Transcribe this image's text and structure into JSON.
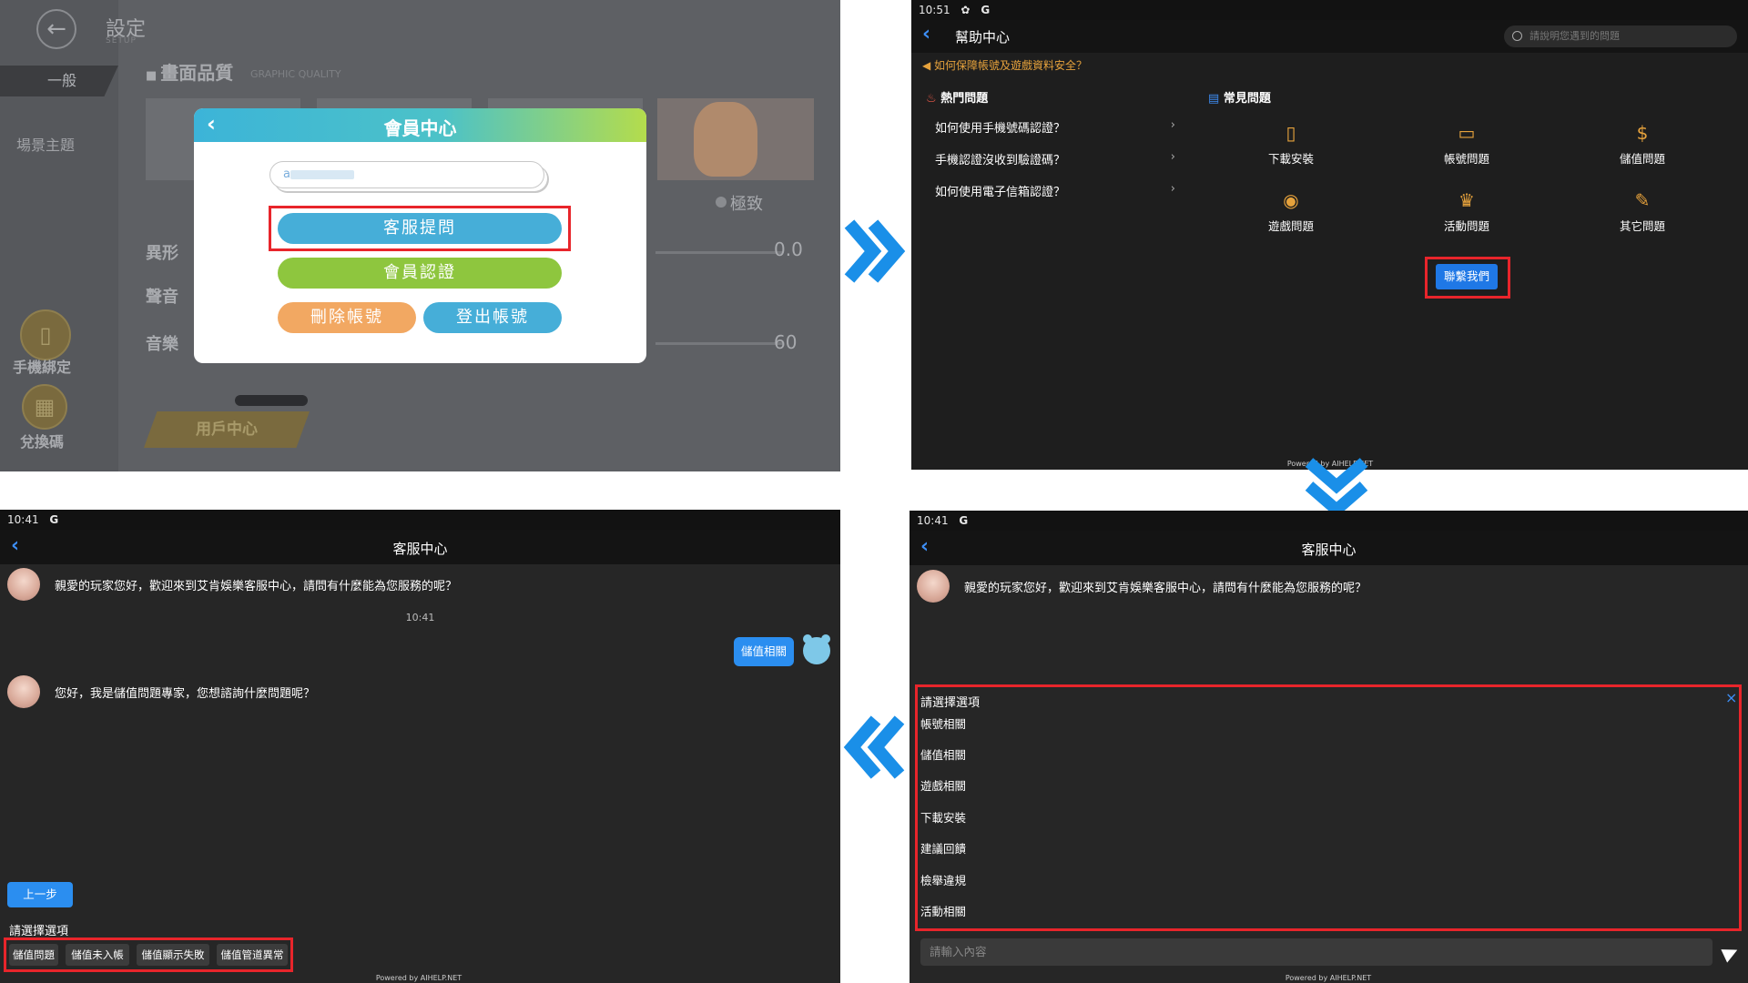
{
  "panel1": {
    "settings_title": "設定",
    "settings_subtitle": "SETUP",
    "tab_general": "一般",
    "tab_scene": "場景主題",
    "graphic_quality": "畫面品質",
    "graphic_quality_en": "GRAPHIC QUALITY",
    "ultra_label": "極致",
    "row_label_1": "異形",
    "row_label_2": "聲音",
    "row_label_3": "音樂",
    "value_1": "0.0",
    "value_3": "60",
    "phone_bind": "手機綁定",
    "redeem_code": "兌換碼",
    "user_center": "用戶中心",
    "modal": {
      "title": "會員中心",
      "account_prefix": "a",
      "btn_customer_service": "客服提問",
      "btn_member_verify": "會員認證",
      "btn_delete_account": "刪除帳號",
      "btn_logout": "登出帳號"
    }
  },
  "panel2": {
    "time": "10:51",
    "status_g": "G",
    "title": "幫助中心",
    "search_placeholder": "請說明您遇到的問題",
    "notice": "如何保障帳號及遊戲資料安全？",
    "hot_title": "熱門問題",
    "hot_items": [
      "如何使用手機號碼認證？",
      "手機認證沒收到驗證碼？",
      "如何使用電子信箱認證？"
    ],
    "chevron": "›",
    "faq_title": "常見問題",
    "faq_items": [
      "下載安裝",
      "帳號問題",
      "儲值問題",
      "遊戲問題",
      "活動問題",
      "其它問題"
    ],
    "contact_button": "聯繫我們",
    "powered": "Powered by AIHELP.NET"
  },
  "panel3": {
    "time": "10:41",
    "status_g": "G",
    "title": "客服中心",
    "greeting": "親愛的玩家您好，歡迎來到艾肯娛樂客服中心，請問有什麼能為您服務的呢？",
    "choice_title": "請選擇選項",
    "close": "×",
    "choices": [
      "帳號相關",
      "儲值相關",
      "遊戲相關",
      "下載安裝",
      "建議回饋",
      "檢舉違規",
      "活動相關"
    ],
    "input_placeholder": "請輸入內容",
    "powered": "Powered by AIHELP.NET"
  },
  "panel4": {
    "time": "10:41",
    "status_g": "G",
    "title": "客服中心",
    "greeting": "親愛的玩家您好，歡迎來到艾肯娛樂客服中心，請問有什麼能為您服務的呢？",
    "msg_time": "10:41",
    "user_message": "儲值相關",
    "reply": "您好，我是儲值問題專家，您想諮詢什麼問題呢？",
    "prev_button": "上一步",
    "choice_title": "請選擇選項",
    "chips": [
      "儲值問題",
      "儲值未入帳",
      "儲值顯示失敗",
      "儲值管道異常"
    ],
    "powered": "Powered by AIHELP.NET"
  },
  "colors": {
    "highlight_red": "#e8252b",
    "arrow_blue": "#1a8fe8",
    "accent_blue": "#2b8ef0",
    "notice_orange": "#e6a23c"
  }
}
